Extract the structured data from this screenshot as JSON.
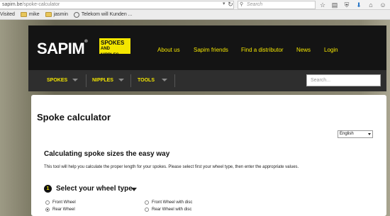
{
  "browser": {
    "url_host": "sapim.be",
    "url_path": "/spoke-calculator",
    "search_placeholder": "Search",
    "bookmarks": [
      "Visited",
      "mike",
      "jasmin",
      "Telekom will Kunden ..."
    ]
  },
  "header": {
    "logo_text": "SAPIM",
    "logo_mark": "®",
    "badge_line1": "SPOKES",
    "badge_line2": "AND NIPPLES",
    "nav": [
      "About us",
      "Sapim friends",
      "Find a distributor",
      "News",
      "Login"
    ]
  },
  "subnav": {
    "items": [
      "SPOKES",
      "NIPPLES",
      "TOOLS"
    ],
    "search_placeholder": "Search..."
  },
  "content": {
    "title": "Spoke calculator",
    "language": "English",
    "heading": "Calculating spoke sizes the easy way",
    "intro": "This tool will help you calculate the proper length for your spokes. Please select first your wheel type, then enter the appropriate values.",
    "step_number": "1",
    "step_title": "Select your wheel type",
    "wheel_options": [
      {
        "label": "Front Wheel",
        "checked": false
      },
      {
        "label": "Rear Wheel",
        "checked": true
      },
      {
        "label": "Front Wheel with disc",
        "checked": false
      },
      {
        "label": "Rear Wheel with disc",
        "checked": false
      }
    ]
  }
}
